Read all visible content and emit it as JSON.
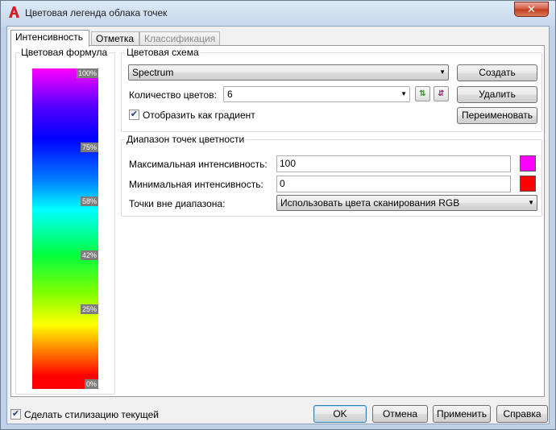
{
  "window": {
    "title": "Цветовая легенда облака точек",
    "close_glyph": "✕"
  },
  "tabs": [
    {
      "label": "Интенсивность",
      "active": true
    },
    {
      "label": "Отметка",
      "active": false
    },
    {
      "label": "Классификация",
      "active": false,
      "disabled": true
    }
  ],
  "formula": {
    "caption": "Цветовая формула",
    "ticks": [
      "100%",
      "75%",
      "58%",
      "42%",
      "25%",
      "0%"
    ]
  },
  "scheme": {
    "caption": "Цветовая схема",
    "scheme_value": "Spectrum",
    "count_label": "Количество цветов:",
    "count_value": "6",
    "gradient_label": "Отобразить как градиент",
    "gradient_checked": "✔",
    "create_button": "Создать",
    "delete_button": "Удалить",
    "rename_button": "Переименовать"
  },
  "range": {
    "caption": "Диапазон точек цветности",
    "max_label": "Максимальная интенсивность:",
    "max_value": "100",
    "max_color": "#ff00ff",
    "min_label": "Минимальная интенсивность:",
    "min_value": "0",
    "min_color": "#ff0000",
    "out_label": "Точки вне диапазона:",
    "out_value": "Использовать цвета сканирования RGB"
  },
  "footer": {
    "current_label": "Сделать стилизацию текущей",
    "current_checked": "✔",
    "ok": "OK",
    "cancel": "Отмена",
    "apply": "Применить",
    "help": "Справка"
  }
}
